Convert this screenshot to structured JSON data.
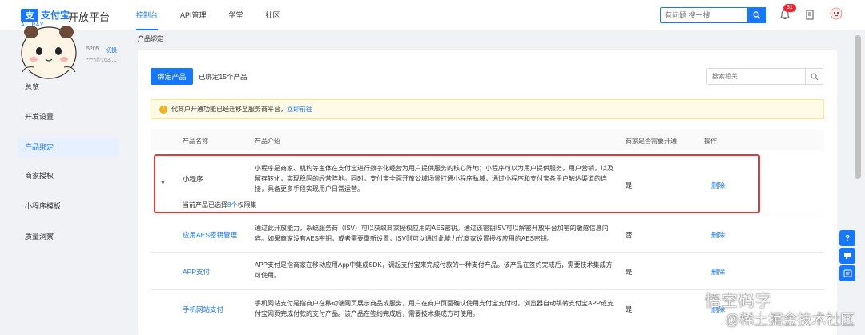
{
  "brand": {
    "logo_text": "支付宝",
    "logo_sub": "ALIPAY",
    "platform": "开放平台"
  },
  "nav": [
    {
      "label": "控制台",
      "active": true
    },
    {
      "label": "API管理"
    },
    {
      "label": "学堂"
    },
    {
      "label": "社区"
    }
  ],
  "search": {
    "placeholder": "有问题 搜一搜"
  },
  "notifications": {
    "count": "31"
  },
  "account": {
    "id": "5205",
    "switch_label": "切换",
    "email": "****@163/..."
  },
  "sidebar": {
    "items": [
      {
        "label": "总览"
      },
      {
        "label": "开发设置"
      },
      {
        "label": "产品绑定",
        "active": true
      },
      {
        "label": "商家授权"
      },
      {
        "label": "小程序模板"
      },
      {
        "label": "质量洞察"
      }
    ]
  },
  "breadcrumb": "产品绑定",
  "toolbar": {
    "bind_button": "绑定产品",
    "bound_count": "已绑定15个产品",
    "search_placeholder": "搜索相关"
  },
  "notice": {
    "text": "代商户开通功能已经迁移至服务商平台，",
    "link": "立即前往"
  },
  "table": {
    "headers": [
      "产品名称",
      "产品介绍",
      "商家是否需要开通",
      "操作"
    ],
    "rows": [
      {
        "name": "小程序",
        "desc": "小程序是商家、机构等主体在支付宝进行数字化经营为用户提供服务的核心阵地；小程序可以为用户提供服务，用户营销，以及留存转化，实现稳固的经营阵地。同时，支付宝全面开放公域场景打通小程序私域，通过小程序和支付宝各用户触达渠道的连接，具备更多手段实现用户日常运营。",
        "need": "是",
        "action": "删除",
        "perm_prefix": "当前产品已选择",
        "perm_count": "8个",
        "perm_suffix": "权限集"
      },
      {
        "name": "应用AES密钥管理",
        "desc": "通过此开放能力，系统服务商（ISV）可以获取商家授权应用的AES密钥。通过该密钥ISV可以解密开放平台加密的敏感信息内容。如果商家没有AES密钥，或者需要重新设置，ISV则可以通过此能力代商家设置授权应用的AES密钥。",
        "need": "否",
        "action": "删除"
      },
      {
        "name": "APP支付",
        "desc": "APP支付是指商家在移动应用App中集成SDK，调起支付宝来完成付款的一种支付产品。该产品在签约完成后，需要技术集成方可使用。",
        "need": "是",
        "action": "删除"
      },
      {
        "name": "手机网站支付",
        "desc": "手机网站支付是指商户在移动端网页展示商品或服务，用户在商户页面确认使用支付宝支付时，浏览器自动跳转支付宝APP或支付宝网页完成付款的支付产品。该产品在签约完成后，需要技术集成方可使用。",
        "need": "是",
        "action": "删除"
      }
    ]
  },
  "watermark": {
    "line1": "悟空码字",
    "line2": "@稀土掘金技术社区"
  },
  "colors": {
    "accent": "#1677ff",
    "highlight": "#e53935",
    "notice_bg": "#fffbe6"
  }
}
